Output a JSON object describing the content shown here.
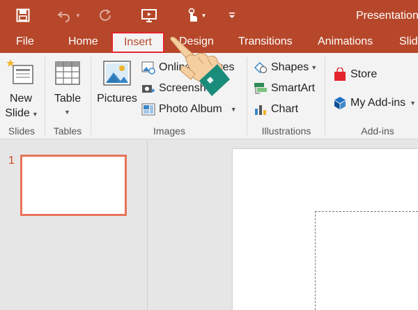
{
  "title_bar": {
    "title": "Presentation",
    "icons": [
      "save-icon",
      "undo-icon",
      "redo-icon",
      "present-icon",
      "touch-mode-icon",
      "customize-icon"
    ]
  },
  "tabs": [
    {
      "label": "File"
    },
    {
      "label": "Home"
    },
    {
      "label": "Insert"
    },
    {
      "label": "Design"
    },
    {
      "label": "Transitions"
    },
    {
      "label": "Animations"
    },
    {
      "label": "Slid"
    }
  ],
  "ribbon": {
    "slides": {
      "new_slide_line1": "New",
      "new_slide_line2": "Slide",
      "group": "Slides"
    },
    "tables": {
      "table": "Table",
      "group": "Tables"
    },
    "images": {
      "pictures": "Pictures",
      "online_pictures": "Online Pictures",
      "screenshot": "Screenshot",
      "photo_album": "Photo Album",
      "group": "Images"
    },
    "illustrations": {
      "shapes": "Shapes",
      "smartart": "SmartArt",
      "chart": "Chart",
      "group": "Illustrations"
    },
    "addins": {
      "store": "Store",
      "my_addins": "My Add-ins",
      "group": "Add-ins"
    }
  },
  "slides_panel": {
    "slide_number": "1"
  },
  "colors": {
    "accent": "#b7472a",
    "active_tab_border": "#e3262c",
    "thumb_border": "#e8735a"
  }
}
